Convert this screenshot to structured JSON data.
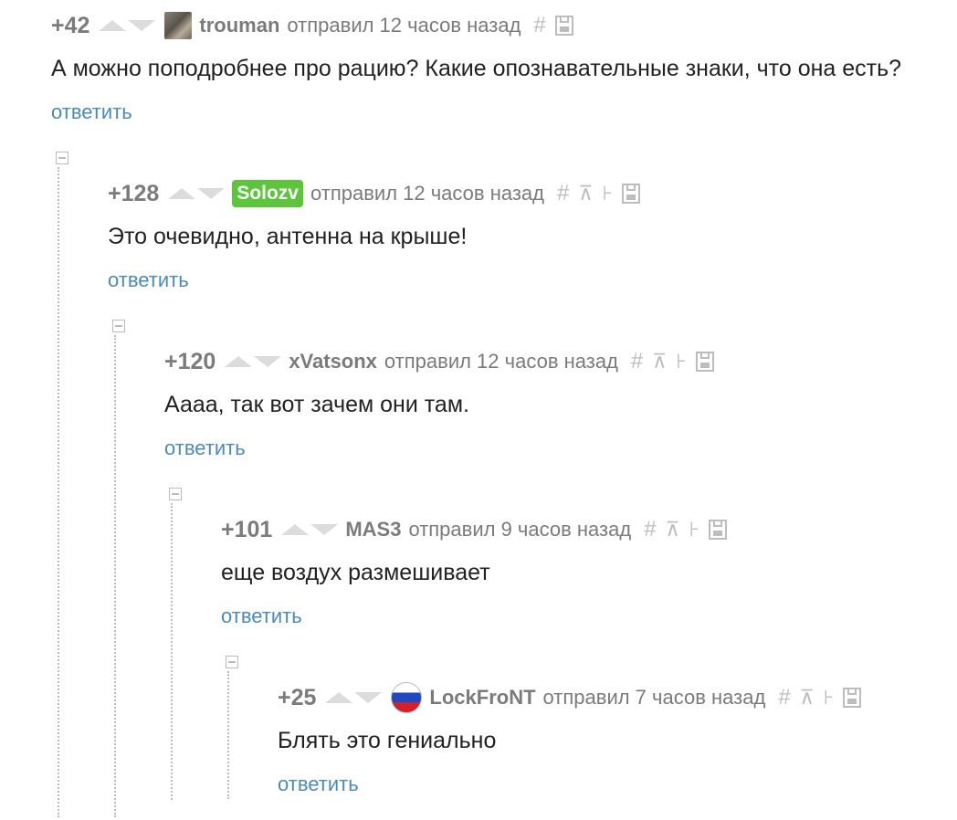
{
  "comments": [
    {
      "rating": "+42",
      "author": "trouman",
      "sent": "отправил 12 часов назад",
      "text": "А можно поподробнее про рацию? Какие опознавательные знаки, что она есть?",
      "reply": "ответить"
    },
    {
      "rating": "+128",
      "author": "Solozv",
      "sent": "отправил 12 часов назад",
      "text": "Это очевидно, антенна на крыше!",
      "reply": "ответить"
    },
    {
      "rating": "+120",
      "author": "xVatsonx",
      "sent": "отправил 12 часов назад",
      "text": "Аааа, так вот зачем они там.",
      "reply": "ответить"
    },
    {
      "rating": "+101",
      "author": "MAS3",
      "sent": "отправил 9 часов назад",
      "text": "еще воздух размешивает",
      "reply": "ответить"
    },
    {
      "rating": "+25",
      "author": "LockFroNT",
      "sent": "отправил 7 часов назад",
      "text": "Блять это гениально",
      "reply": "ответить"
    }
  ],
  "icons": {
    "hash": "#",
    "parent": "⊼",
    "branch": "⊦"
  },
  "colors": {
    "link": "#4a8bbd",
    "badge": "#5cc53b",
    "meta": "#7b7b7b"
  }
}
